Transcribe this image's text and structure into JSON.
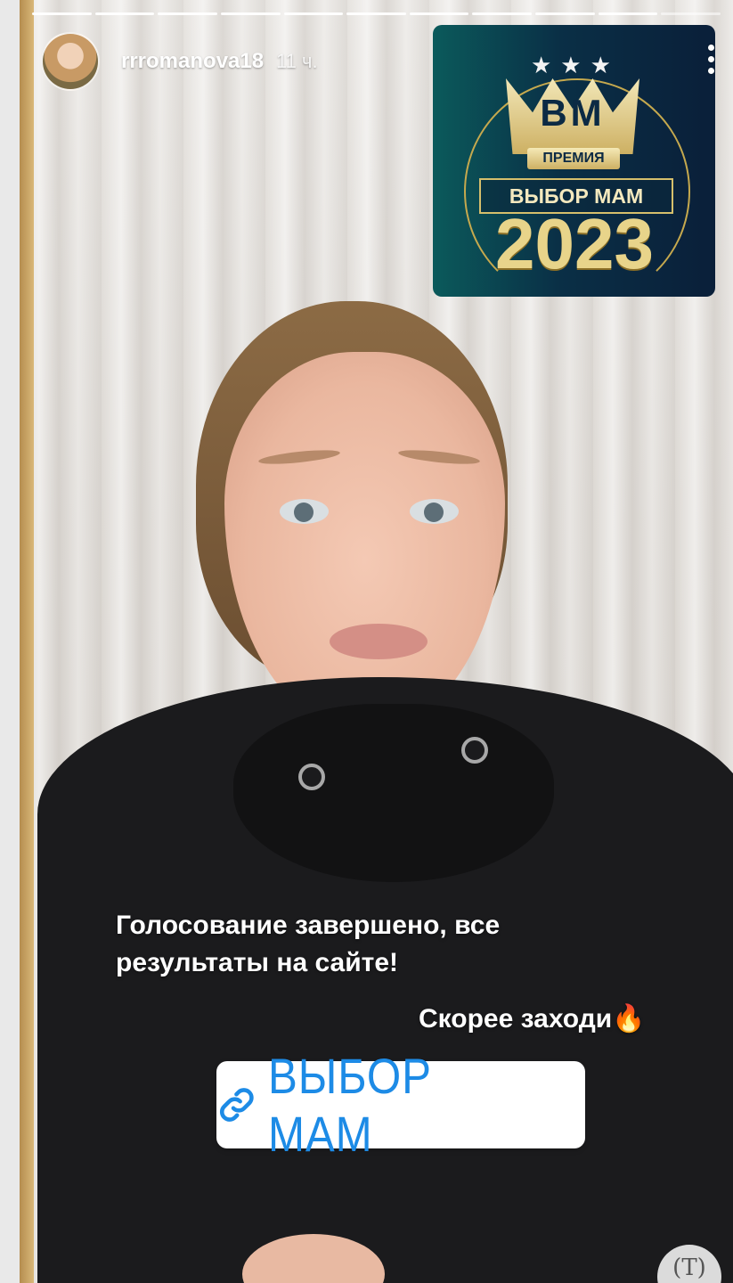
{
  "story": {
    "progress_total": 11,
    "progress_done": 10
  },
  "header": {
    "username": "rrromanova18",
    "time": "11 ч."
  },
  "award": {
    "logo_text": "ВМ",
    "label_top": "ПРЕМИЯ",
    "banner": "ВЫБОР МАМ",
    "year": "2023"
  },
  "caption": {
    "line1": "Голосование завершено, все результаты на сайте!",
    "line2": "Скорее заходи",
    "emoji": "🔥"
  },
  "link": {
    "label": "ВЫБОР МАМ",
    "color": "#1d8be6"
  },
  "controls": {
    "more_icon": "more-vertical-icon",
    "translate_icon": "translate-text-icon"
  }
}
